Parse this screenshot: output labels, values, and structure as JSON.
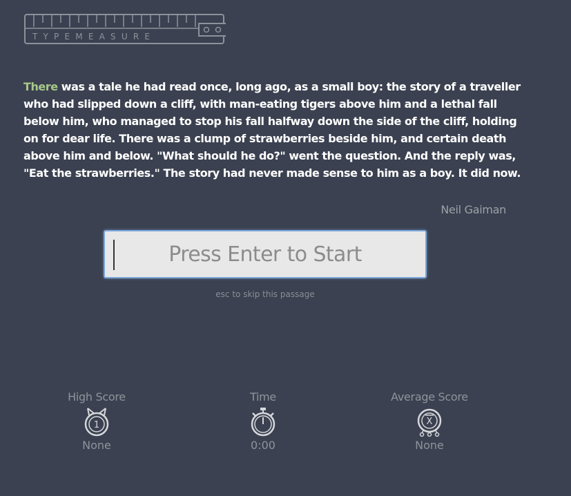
{
  "logo": {
    "text": "TYPEMEASURE"
  },
  "passage": {
    "current_word": "There",
    "rest": " was a tale he had read once, long ago, as a small boy: the story of a traveller who had slipped down a cliff, with man-eating tigers above him and a lethal fall below him, who managed to stop his fall halfway down the side of the cliff, holding on for dear life. There was a clump of strawberries beside him, and certain death above him and below. \"What should he do?\" went the question. And the reply was, \"Eat the strawberries.\" The story had never made sense to him as a boy. It did now.",
    "author": "Neil Gaiman",
    "current_word_color": "#a8c88a"
  },
  "input": {
    "placeholder": "Press Enter to Start",
    "hint": "esc to skip this passage"
  },
  "stats": {
    "high_score": {
      "label": "High Score",
      "value": "None",
      "icon": "medal-1-icon",
      "icon_text": "1"
    },
    "time": {
      "label": "Time",
      "value": "0:00",
      "icon": "stopwatch-icon"
    },
    "average": {
      "label": "Average Score",
      "value": "None",
      "icon": "x-bar-icon",
      "icon_text": "X"
    }
  }
}
